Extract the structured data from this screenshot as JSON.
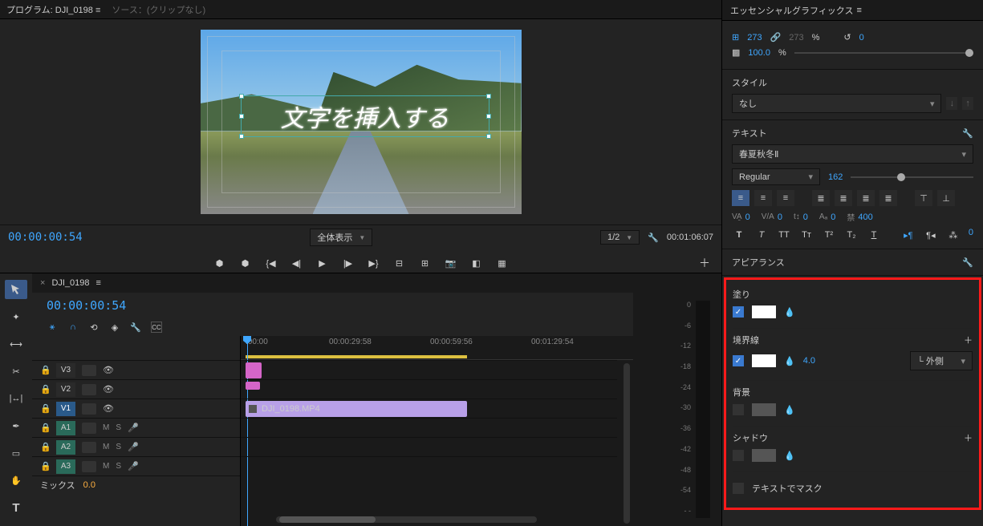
{
  "program": {
    "tab_prefix": "プログラム:",
    "sequence": "DJI_0198",
    "source_tab": "ソース：(クリップなし)",
    "overlay_text": "文字を挿入する",
    "tc_left": "00:00:00:54",
    "tc_right": "00:01:06:07",
    "fit_label": "全体表示",
    "zoom_label": "1/2"
  },
  "timeline": {
    "tab": "DJI_0198",
    "tc": "00:00:00:54",
    "ruler": [
      ":00:00",
      "00:00:29:58",
      "00:00:59:56",
      "00:01:29:54"
    ],
    "tracks_v": [
      "V3",
      "V2",
      "V1"
    ],
    "tracks_a": [
      "A1",
      "A2",
      "A3"
    ],
    "ms_m": "M",
    "ms_s": "S",
    "mix_label": "ミックス",
    "mix_value": "0.0",
    "clip_name": "DJI_0198.MP4",
    "levels": [
      "0",
      "-6",
      "-12",
      "-18",
      "-24",
      "-30",
      "-36",
      "-42",
      "-48",
      "-54",
      "- -"
    ]
  },
  "eg": {
    "panel_title": "エッセンシャルグラフィックス",
    "pin_w": "273",
    "pin_h": "273",
    "pct": "%",
    "rot": "0",
    "opacity": "100.0",
    "opacity_pct": "%",
    "style_title": "スタイル",
    "style_value": "なし",
    "text_title": "テキスト",
    "font": "春夏秋冬Ⅱ",
    "weight": "Regular",
    "size": "162",
    "va": "0",
    "vah": "0",
    "tsu": "0",
    "aa": "0",
    "haba": "400",
    "appearance_title": "アピアランス",
    "fill": "塗り",
    "stroke": "境界線",
    "stroke_w": "4.0",
    "stroke_pos": "外側",
    "bg": "背景",
    "shadow": "シャドウ",
    "mask": "テキストでマスク"
  }
}
